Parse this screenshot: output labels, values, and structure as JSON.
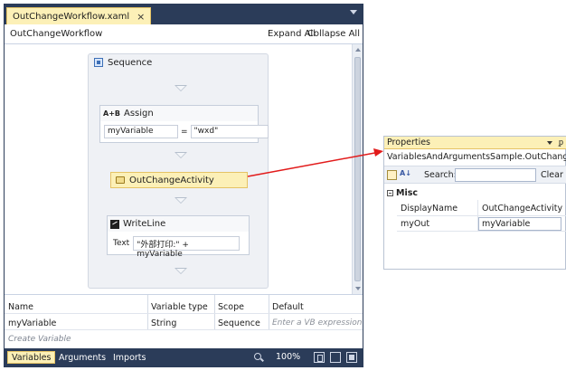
{
  "designer": {
    "tab_label": "OutChangeWorkflow.xaml",
    "tab_close": "×",
    "breadcrumb": "OutChangeWorkflow",
    "expand_all": "Expand All",
    "collapse_all": "Collapse All",
    "sequence_label": "Sequence",
    "assign": {
      "label": "Assign",
      "to": "myVariable",
      "equals": "=",
      "value": "\"wxd\""
    },
    "outchange_label": "OutChangeActivity",
    "writeline": {
      "label": "WriteLine",
      "text_label": "Text",
      "text_value": "\"外部打印:\" + myVariable"
    }
  },
  "variables": {
    "columns": [
      "Name",
      "Variable type",
      "Scope",
      "Default"
    ],
    "rows": [
      {
        "name": "myVariable",
        "type": "String",
        "scope": "Sequence",
        "default": "Enter a VB expression"
      }
    ],
    "create_label": "Create Variable"
  },
  "bottom_bar": {
    "tabs": [
      "Variables",
      "Arguments",
      "Imports"
    ],
    "zoom": "100%"
  },
  "properties": {
    "title": "Properties",
    "pin": "ᵱ",
    "object": "VariablesAndArgumentsSample.OutChange.",
    "search_label": "Search:",
    "clear": "Clear",
    "category": "Misc",
    "rows": [
      {
        "name": "DisplayName",
        "value": "OutChangeActivity"
      },
      {
        "name": "myOut",
        "value": "myVariable"
      }
    ]
  },
  "colors": {
    "chrome": "#2b3c59",
    "selection": "#fcf0b7",
    "arrow": "#e21b1b"
  }
}
